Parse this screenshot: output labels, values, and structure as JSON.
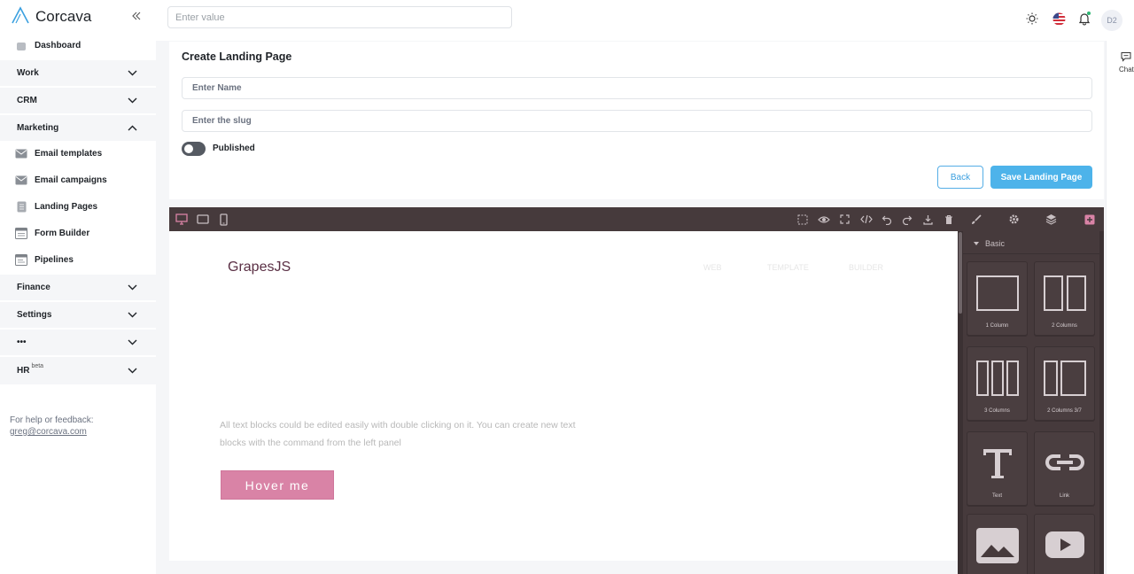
{
  "brand": {
    "name": "Corcava"
  },
  "sidebar": {
    "dashboard": "Dashboard",
    "groups": {
      "work": "Work",
      "crm": "CRM",
      "marketing": "Marketing",
      "finance": "Finance",
      "settings": "Settings",
      "more": "•••",
      "hr": "HR",
      "hr_badge": "beta"
    },
    "marketing_items": {
      "email_templates": "Email templates",
      "email_campaigns": "Email campaigns",
      "landing_pages": "Landing Pages",
      "form_builder": "Form Builder",
      "pipelines": "Pipelines"
    },
    "help_text": "For help or feedback:",
    "help_email": "greg@corcava.com"
  },
  "topbar": {
    "search_placeholder": "Enter value",
    "avatar_initials": "D2"
  },
  "chat": {
    "label": "Chat"
  },
  "form": {
    "title": "Create Landing Page",
    "name_placeholder": "Enter Name",
    "slug_placeholder": "Enter the slug",
    "published_label": "Published",
    "published": false,
    "back_label": "Back",
    "save_label": "Save Landing Page"
  },
  "editor": {
    "canvas": {
      "logo": "GrapesJS",
      "menu": [
        "WEB",
        "TEMPLATE",
        "BUILDER"
      ],
      "text": "All text blocks could be edited easily with double clicking on it. You can create new text blocks with the command from the left panel",
      "button": "Hover me"
    },
    "panel": {
      "section": "Basic",
      "blocks": [
        "1 Column",
        "2 Columns",
        "3 Columns",
        "2 Columns 3/7",
        "Text",
        "Link"
      ]
    }
  },
  "colors": {
    "accent": "#4db3ea",
    "editor_bg": "#463a3c",
    "editor_accent": "#d983a6"
  }
}
